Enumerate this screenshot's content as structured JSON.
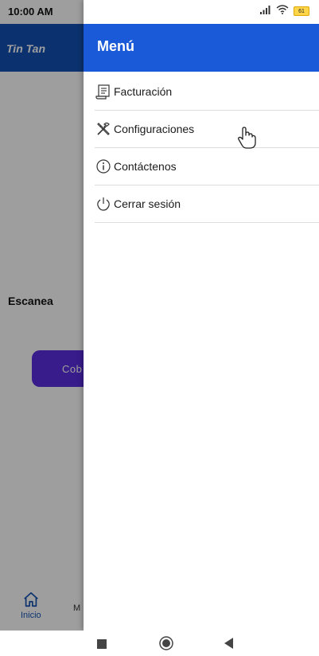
{
  "status_bar": {
    "time": "10:00 AM",
    "battery_level": "61"
  },
  "app": {
    "title": "Tin Tan",
    "scan_text": "Escanea",
    "primary_button_label": "Cob",
    "bottom_nav": {
      "items": [
        {
          "label": "Inicio",
          "icon": "home-icon",
          "active": true
        },
        {
          "label": "M",
          "icon": "",
          "active": false
        }
      ]
    }
  },
  "drawer": {
    "title": "Menú",
    "header_color": "#1a5ad8",
    "items": [
      {
        "label": "Facturación",
        "icon": "invoice-icon"
      },
      {
        "label": "Configuraciones",
        "icon": "tools-icon"
      },
      {
        "label": "Contáctenos",
        "icon": "info-icon"
      },
      {
        "label": "Cerrar sesión",
        "icon": "power-icon"
      }
    ]
  },
  "colors": {
    "app_bar": "#1252b3",
    "button": "#5b2ee0",
    "scrim": "rgba(0,0,0,0.38)"
  }
}
